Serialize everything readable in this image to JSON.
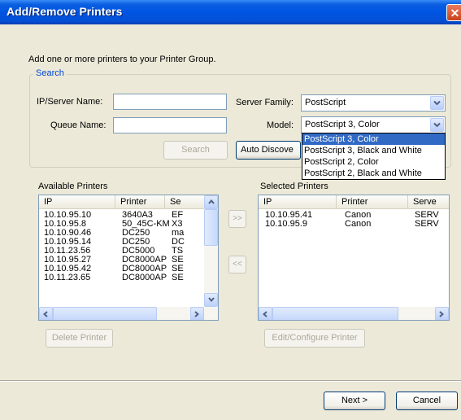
{
  "window": {
    "title": "Add/Remove Printers",
    "close_label": "✕"
  },
  "intro_text": "Add one or more printers to your Printer Group.",
  "search": {
    "group_label": "Search",
    "ip_label": "IP/Server Name:",
    "ip_value": "",
    "queue_label": "Queue Name:",
    "queue_value": "",
    "server_family_label": "Server Family:",
    "server_family_value": "PostScript",
    "model_label": "Model:",
    "model_value": "PostScript 3, Color",
    "search_button": "Search",
    "auto_discover_button": "Auto Discove"
  },
  "model_dropdown": {
    "options": [
      "PostScript 3, Color",
      "PostScript 3, Black and White",
      "PostScript 2, Color",
      "PostScript 2, Black and White"
    ],
    "selected_index": 0
  },
  "available": {
    "label": "Available Printers",
    "columns": [
      "IP",
      "Printer",
      "Se"
    ],
    "rows": [
      [
        "10.10.95.10",
        "3640A3",
        "EF"
      ],
      [
        "10.10.95.8",
        "50_45C-KM",
        "X3"
      ],
      [
        "10.10.90.46",
        "DC250",
        "ma"
      ],
      [
        "10.10.95.14",
        "DC250",
        "DC"
      ],
      [
        "10.11.23.56",
        "DC5000",
        "TS"
      ],
      [
        "10.10.95.27",
        "DC8000AP",
        "SE"
      ],
      [
        "10.10.95.42",
        "DC8000AP",
        "SE"
      ],
      [
        "10.11.23.65",
        "DC8000AP",
        "SE"
      ]
    ]
  },
  "selected": {
    "label": "Selected Printers",
    "columns": [
      "IP",
      "Printer",
      "Serve"
    ],
    "rows": [
      [
        "10.10.95.41",
        "Canon",
        "SERV"
      ],
      [
        "10.10.95.9",
        "Canon",
        "SERV"
      ]
    ]
  },
  "move_right_label": ">>",
  "move_left_label": "<<",
  "delete_button": "Delete Printer",
  "edit_button": "Edit/Configure Printer",
  "next_button": "Next >",
  "cancel_button": "Cancel"
}
